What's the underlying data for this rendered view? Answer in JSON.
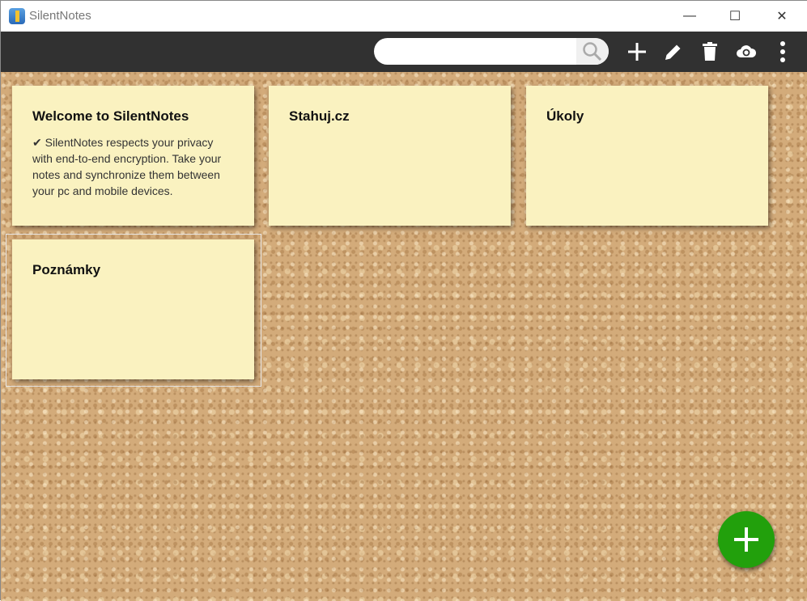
{
  "window": {
    "title": "SilentNotes",
    "minimize": "—",
    "maximize": "☐",
    "close": "✕"
  },
  "toolbar": {
    "search_placeholder": "",
    "search_value": "",
    "icons": [
      "search-icon",
      "add-icon",
      "edit-icon",
      "delete-icon",
      "cloud-sync-icon",
      "more-icon"
    ]
  },
  "notes": [
    {
      "title": "Welcome to SilentNotes",
      "check": "✔",
      "body": "SilentNotes respects your privacy with end-to-end encryption. Take your notes and synchronize them between your pc and mobile devices."
    },
    {
      "title": "Stahuj.cz",
      "body": ""
    },
    {
      "title": "Úkoly",
      "body": ""
    },
    {
      "title": "Poznámky",
      "body": ""
    }
  ],
  "colors": {
    "toolbar": "#313131",
    "note": "#faf2c0",
    "fab": "#22a00c"
  }
}
